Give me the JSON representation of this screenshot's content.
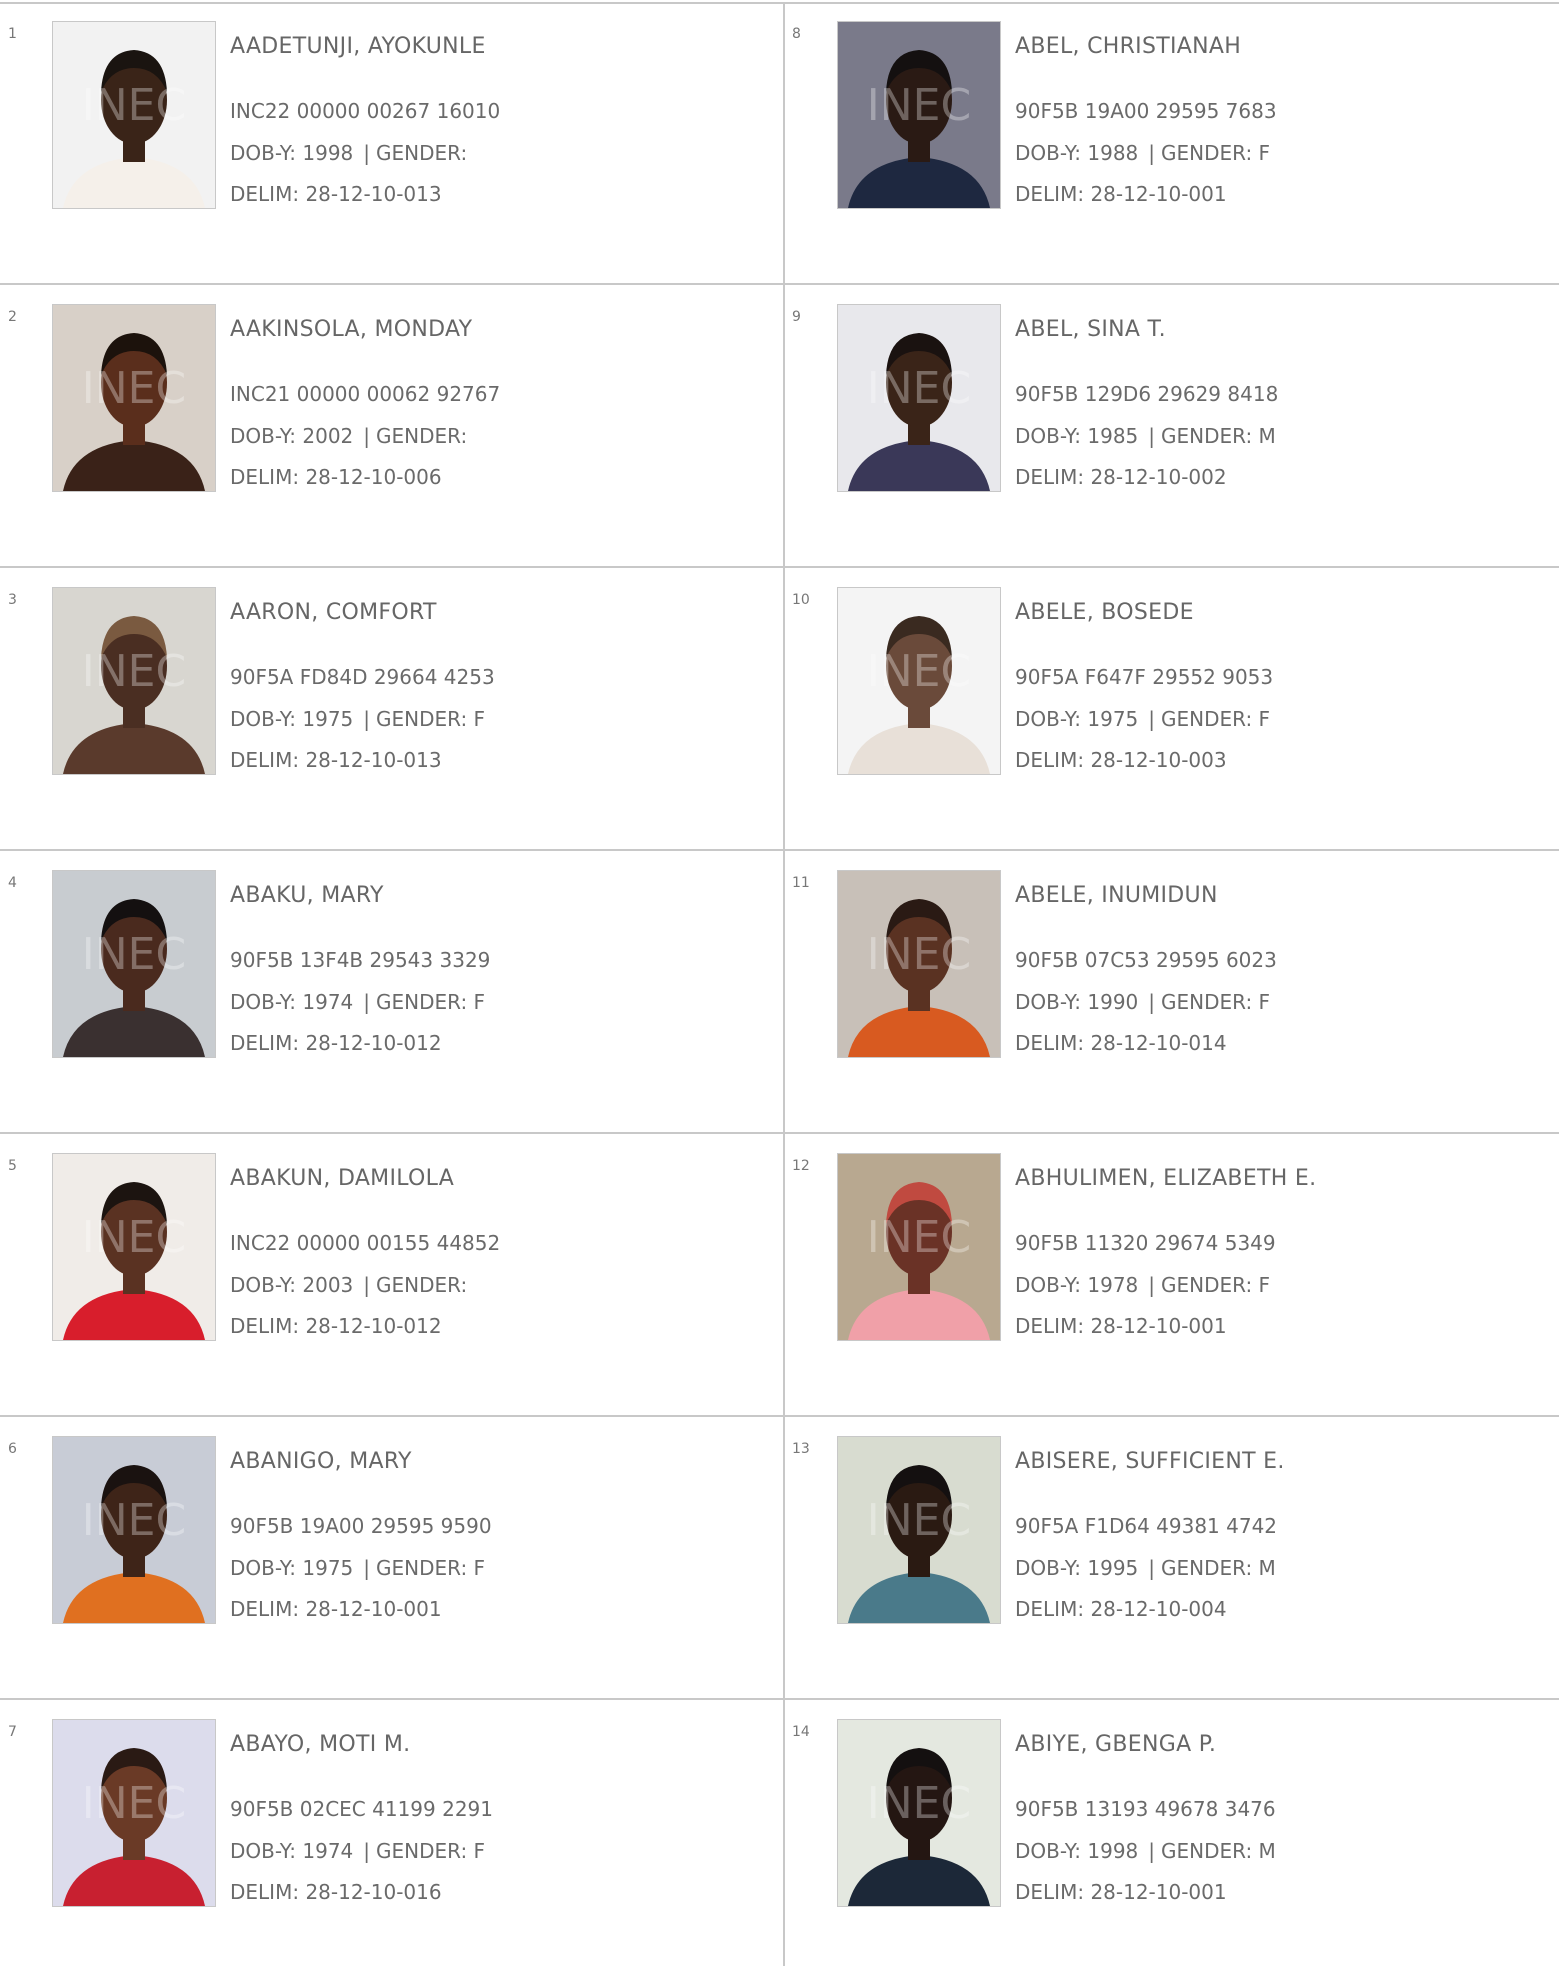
{
  "voters_left": [
    {
      "num": "1",
      "name": "AADETUNJI, AYOKUNLE",
      "vin": "INC22 00000 00267 16010",
      "dob_label": "DOB-Y:",
      "dob": "1998",
      "gender_label": "GENDER:",
      "gender": "",
      "delim_label": "DELIM:",
      "delim": "28-12-10-013",
      "photo": {
        "bg": "#f2f2f2",
        "skin": "#3a2418",
        "hair": "#1a1410",
        "cloth": "#f5f0ea"
      }
    },
    {
      "num": "2",
      "name": "AAKINSOLA, MONDAY",
      "vin": "INC21 00000 00062 92767",
      "dob_label": "DOB-Y:",
      "dob": "2002",
      "gender_label": "GENDER:",
      "gender": "",
      "delim_label": "DELIM:",
      "delim": "28-12-10-006",
      "photo": {
        "bg": "#d8d0c8",
        "skin": "#5a2e1c",
        "hair": "#1c120c",
        "cloth": "#3a2218"
      }
    },
    {
      "num": "3",
      "name": "AARON, COMFORT",
      "vin": "90F5A FD84D 29664 4253",
      "dob_label": "DOB-Y:",
      "dob": "1975",
      "gender_label": "GENDER:",
      "gender": "F",
      "delim_label": "DELIM:",
      "delim": "28-12-10-013",
      "photo": {
        "bg": "#d8d6d0",
        "skin": "#4a2e22",
        "hair": "#7a5a40",
        "cloth": "#5a3a2c"
      }
    },
    {
      "num": "4",
      "name": "ABAKU, MARY",
      "vin": "90F5B 13F4B 29543 3329",
      "dob_label": "DOB-Y:",
      "dob": "1974",
      "gender_label": "GENDER:",
      "gender": "F",
      "delim_label": "DELIM:",
      "delim": "28-12-10-012",
      "photo": {
        "bg": "#c8ccd0",
        "skin": "#4a2a1e",
        "hair": "#141010",
        "cloth": "#3a3030"
      }
    },
    {
      "num": "5",
      "name": "ABAKUN, DAMILOLA",
      "vin": "INC22 00000 00155 44852",
      "dob_label": "DOB-Y:",
      "dob": "2003",
      "gender_label": "GENDER:",
      "gender": "",
      "delim_label": "DELIM:",
      "delim": "28-12-10-012",
      "photo": {
        "bg": "#f0ece8",
        "skin": "#5a3222",
        "hair": "#1c1410",
        "cloth": "#d81e2c"
      }
    },
    {
      "num": "6",
      "name": "ABANIGO, MARY",
      "vin": "90F5B 19A00 29595 9590",
      "dob_label": "DOB-Y:",
      "dob": "1975",
      "gender_label": "GENDER:",
      "gender": "F",
      "delim_label": "DELIM:",
      "delim": "28-12-10-001",
      "photo": {
        "bg": "#c8ccd6",
        "skin": "#3e2418",
        "hair": "#1a1210",
        "cloth": "#e07020"
      }
    },
    {
      "num": "7",
      "name": "ABAYO, MOTI M.",
      "vin": "90F5B 02CEC 41199 2291",
      "dob_label": "DOB-Y:",
      "dob": "1974",
      "gender_label": "GENDER:",
      "gender": "F",
      "delim_label": "DELIM:",
      "delim": "28-12-10-016",
      "photo": {
        "bg": "#dcdcec",
        "skin": "#6a3a26",
        "hair": "#2a1a14",
        "cloth": "#c82030"
      }
    }
  ],
  "voters_right": [
    {
      "num": "8",
      "name": "ABEL, CHRISTIANAH",
      "vin": "90F5B 19A00 29595 7683",
      "dob_label": "DOB-Y:",
      "dob": "1988",
      "gender_label": "GENDER:",
      "gender": "F",
      "delim_label": "DELIM:",
      "delim": "28-12-10-001",
      "photo": {
        "bg": "#7a7a8a",
        "skin": "#2a1a14",
        "hair": "#141010",
        "cloth": "#1e2840"
      }
    },
    {
      "num": "9",
      "name": "ABEL, SINA T.",
      "vin": "90F5B 129D6 29629 8418",
      "dob_label": "DOB-Y:",
      "dob": "1985",
      "gender_label": "GENDER:",
      "gender": "M",
      "delim_label": "DELIM:",
      "delim": "28-12-10-002",
      "photo": {
        "bg": "#e8e8ec",
        "skin": "#3a2418",
        "hair": "#1a1210",
        "cloth": "#3a3858"
      }
    },
    {
      "num": "10",
      "name": "ABELE, BOSEDE",
      "vin": "90F5A F647F 29552 9053",
      "dob_label": "DOB-Y:",
      "dob": "1975",
      "gender_label": "GENDER:",
      "gender": "F",
      "delim_label": "DELIM:",
      "delim": "28-12-10-003",
      "photo": {
        "bg": "#f4f4f4",
        "skin": "#6a4a3a",
        "hair": "#3a2a20",
        "cloth": "#e8e0d8"
      }
    },
    {
      "num": "11",
      "name": "ABELE, INUMIDUN",
      "vin": "90F5B 07C53 29595 6023",
      "dob_label": "DOB-Y:",
      "dob": "1990",
      "gender_label": "GENDER:",
      "gender": "F",
      "delim_label": "DELIM:",
      "delim": "28-12-10-014",
      "photo": {
        "bg": "#c8c0b8",
        "skin": "#5a3222",
        "hair": "#2a1a14",
        "cloth": "#d85a20"
      }
    },
    {
      "num": "12",
      "name": "ABHULIMEN, ELIZABETH E.",
      "vin": "90F5B 11320 29674 5349",
      "dob_label": "DOB-Y:",
      "dob": "1978",
      "gender_label": "GENDER:",
      "gender": "F",
      "delim_label": "DELIM:",
      "delim": "28-12-10-001",
      "photo": {
        "bg": "#b8a890",
        "skin": "#6a3226",
        "hair": "#c04a40",
        "cloth": "#f0a0a8"
      }
    },
    {
      "num": "13",
      "name": "ABISERE, SUFFICIENT E.",
      "vin": "90F5A F1D64 49381 4742",
      "dob_label": "DOB-Y:",
      "dob": "1995",
      "gender_label": "GENDER:",
      "gender": "M",
      "delim_label": "DELIM:",
      "delim": "28-12-10-004",
      "photo": {
        "bg": "#d8dcd0",
        "skin": "#2a1a12",
        "hair": "#141010",
        "cloth": "#4a7a8a"
      }
    },
    {
      "num": "14",
      "name": "ABIYE, GBENGA P.",
      "vin": "90F5B 13193 49678 3476",
      "dob_label": "DOB-Y:",
      "dob": "1998",
      "gender_label": "GENDER:",
      "gender": "M",
      "delim_label": "DELIM:",
      "delim": "28-12-10-001",
      "photo": {
        "bg": "#e4e8e0",
        "skin": "#241612",
        "hair": "#141010",
        "cloth": "#1c2838"
      }
    }
  ],
  "photo_watermark": "INEC"
}
